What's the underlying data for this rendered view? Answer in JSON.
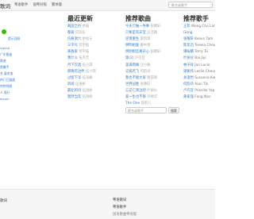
{
  "header": {
    "logo": "歌词",
    "nav": [
      "粤语歌手",
      "国粤对照",
      "繁体版"
    ],
    "search_placeholder": "歌名或歌手"
  },
  "left": {
    "items": [
      {
        "text": "提示回顾"
      },
      {
        "text": "ryonid"
      },
      {
        "text": "广东歌迷"
      },
      {
        "text": "歌曲"
      },
      {
        "text": "首播手"
      },
      {
        "text": "名  要求查"
      },
      {
        "text": "热门已展翅"
      },
      {
        "text": "特供阿朗"
      },
      {
        "text": "人 版行"
      },
      {
        "text": "ieyoni"
      }
    ]
  },
  "latest": {
    "title": "最近更新",
    "items": [
      {
        "song": "两田之约",
        "artist": "余楠"
      },
      {
        "song": "都爱",
        "artist": "何润东"
      },
      {
        "song": "伤痕洞穴",
        "artist": "余佑宁"
      },
      {
        "song": "三千号",
        "artist": "何宇拓"
      },
      {
        "song": "黄昏家",
        "artist": "何宇拓"
      },
      {
        "song": "我什么",
        "artist": "伍杰芳"
      },
      {
        "song": "月下饮酒",
        "artist": "伍小琪"
      },
      {
        "song": "那晚年边伴",
        "artist": "伍小琪"
      },
      {
        "song": "过客下洋",
        "artist": "伍洋峰"
      },
      {
        "song": "听闻",
        "artist": "伍语彬"
      },
      {
        "song": "最北的诗",
        "artist": "伍语彬"
      },
      {
        "song": "黯然当年",
        "artist": "伍语彬"
      }
    ]
  },
  "recommended": {
    "title": "推荐歌曲",
    "items": [
      {
        "song": "今天只做一件事",
        "artist": "张敬轩"
      },
      {
        "song": "只要是有天堂",
        "artist": "汪佳颖"
      },
      {
        "song": "逆境重生",
        "artist": "薛凯琪"
      },
      {
        "song": "明明相爱",
        "artist": "鄭中基"
      },
      {
        "song": "明明相恋真开心",
        "artist": "张敬轩"
      },
      {
        "song": "第(2)",
        "artist": "卢巧音"
      },
      {
        "song": "美满而痛",
        "artist": "汪小敏"
      },
      {
        "song": "记爱若飞",
        "artist": "何韵诗"
      },
      {
        "song": "我也不能大家",
        "artist": "谢霆锋"
      },
      {
        "song": "世界战胜",
        "artist": "张敬轩"
      },
      {
        "song": "忘记它哭泣吧",
        "artist": "叶丽仪"
      },
      {
        "song": "爱一生也不够",
        "artist": "刘德华"
      },
      {
        "song": "The One",
        "artist": "容祖儿"
      }
    ],
    "search_placeholder": "歌名或歌手",
    "search_button": "搜索"
  },
  "singers": {
    "title": "推荐歌手",
    "items": [
      {
        "zh": "王菲",
        "en": "Wong Cho Lam"
      },
      {
        "zh": "Gong",
        "en": ""
      },
      {
        "zh": "张敬轩",
        "en": "Kelvin Tam"
      },
      {
        "zh": "陈奕迅",
        "en": "Teresa Cheung"
      },
      {
        "zh": "谭咏麟",
        "en": "Terry Tu"
      },
      {
        "zh": "叶丽仪",
        "en": "Bai Jiyi"
      },
      {
        "zh": "林子祥",
        "en": "Jan Lucio"
      },
      {
        "zh": "梁朝伟",
        "en": "Leslie Cheung"
      },
      {
        "zh": "关淑怡",
        "en": "Susanna Kwan"
      },
      {
        "zh": "何韵诗",
        "en": "Alan Tin"
      },
      {
        "zh": "卢巧音",
        "en": "Priscilla Yap"
      },
      {
        "zh": "黄家强",
        "en": "Fong Nan"
      }
    ]
  },
  "footer": {
    "left": "歌词",
    "right_title": "粤语歌词",
    "right_sub1": "粤语歌手",
    "right_sub2": "国语歌曲粤语版"
  }
}
